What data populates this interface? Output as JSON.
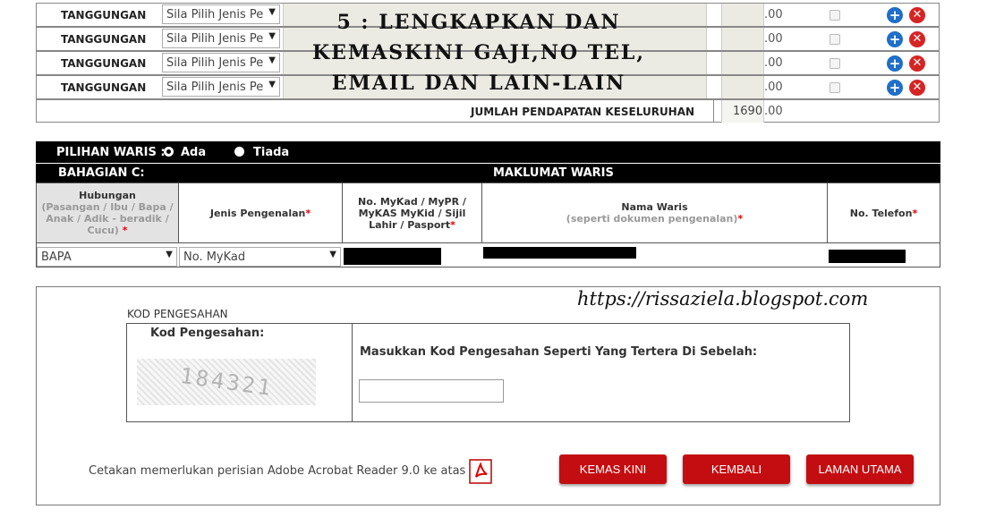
{
  "income_rows": [
    {
      "label": "TANGGUNGAN",
      "select_value": "Sila Pilih Jenis Pe",
      "amount": ".00"
    },
    {
      "label": "TANGGUNGAN",
      "select_value": "Sila Pilih Jenis Pe",
      "amount": ".00"
    },
    {
      "label": "TANGGUNGAN",
      "select_value": "Sila Pilih Jenis Pe",
      "amount": ".00"
    },
    {
      "label": "TANGGUNGAN",
      "select_value": "Sila Pilih Jenis Pe",
      "amount": ".00"
    }
  ],
  "overlay_title": [
    "5 : LENGKAPKAN DAN",
    "KEMASKINI GAJI,NO TEL,",
    "EMAIL DAN LAIN-LAIN"
  ],
  "total": {
    "label": "JUMLAH PENDAPATAN KESELURUHAN",
    "value": "1690",
    "decimals": ".00"
  },
  "waris": {
    "pilihan_label": "PILIHAN WARIS :",
    "option_ada": "Ada",
    "option_tiada": "Tiada",
    "section": "BAHAGIAN C:",
    "section_title": "MAKLUMAT WARIS",
    "headers": {
      "hubungan": "Hubungan",
      "hubungan_sub": "(Pasangan / Ibu / Bapa / Anak / Adik - beradik / Cucu)",
      "jenis": "Jenis Pengenalan",
      "nomykad": "No. MyKad / MyPR / MyKAS MyKid / Sijil Lahir / Pasport",
      "nama": "Nama Waris",
      "nama_sub": "(seperti dokumen pengenalan)",
      "telefon": "No. Telefon",
      "req": "*"
    },
    "row": {
      "hubungan": "BAPA",
      "jenis": "No. MyKad"
    }
  },
  "watermark": "https://rissaziela.blogspot.com",
  "verification": {
    "title": "KOD PENGESAHAN",
    "code_label": "Kod Pengesahan:",
    "captcha_text": "184321",
    "instruction": "Masukkan Kod Pengesahan Seperti Yang Tertera Di Sebelah:",
    "input_value": ""
  },
  "footer": {
    "note": "Cetakan memerlukan perisian Adobe Acrobat Reader 9.0 ke atas",
    "btn_kemas": "KEMAS KINI",
    "btn_kembali": "KEMBALI",
    "btn_laman": "LAMAN UTAMA"
  },
  "colors": {
    "button_red": "#c40d10",
    "add_blue": "#1e6fc9",
    "delete_red": "#d62424"
  },
  "icons": {
    "add": "plus-circle-icon",
    "delete": "x-circle-icon",
    "pdf": "pdf-icon"
  }
}
